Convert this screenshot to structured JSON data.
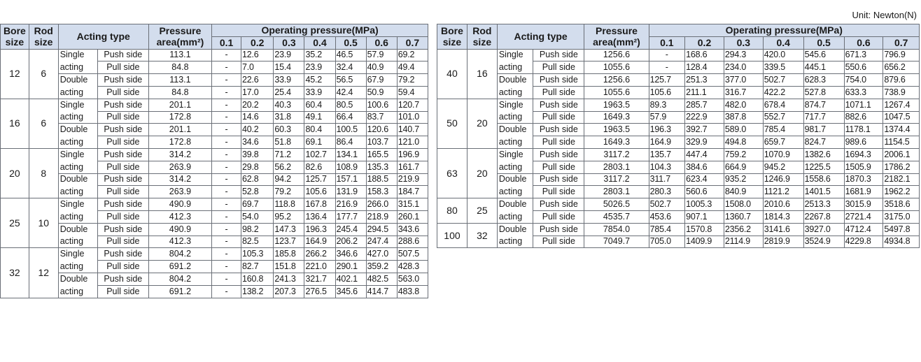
{
  "unit": "Unit: Newton(N)",
  "header": {
    "bore": [
      "Bore",
      "size"
    ],
    "rod": [
      "Rod",
      "size"
    ],
    "acting_type": "Acting type",
    "pressure_area": [
      "Pressure",
      "area(mm²)"
    ],
    "operating_pressure": "Operating pressure(MPa)",
    "pressures": [
      "0.1",
      "0.2",
      "0.3",
      "0.4",
      "0.5",
      "0.6",
      "0.7"
    ]
  },
  "left": [
    {
      "bore": "12",
      "rod": "6",
      "rows": [
        {
          "act": "Single",
          "side": "Push side",
          "area": "113.1",
          "vals": [
            "-",
            "12.6",
            "23.9",
            "35.2",
            "46.5",
            "57.9",
            "69.2"
          ]
        },
        {
          "act": "acting",
          "side": "Pull side",
          "area": "84.8",
          "vals": [
            "-",
            "7.0",
            "15.4",
            "23.9",
            "32.4",
            "40.9",
            "49.4"
          ]
        },
        {
          "act": "Double",
          "side": "Push side",
          "area": "113.1",
          "vals": [
            "-",
            "22.6",
            "33.9",
            "45.2",
            "56.5",
            "67.9",
            "79.2"
          ]
        },
        {
          "act": "acting",
          "side": "Pull side",
          "area": "84.8",
          "vals": [
            "-",
            "17.0",
            "25.4",
            "33.9",
            "42.4",
            "50.9",
            "59.4"
          ]
        }
      ]
    },
    {
      "bore": "16",
      "rod": "6",
      "rows": [
        {
          "act": "Single",
          "side": "Push side",
          "area": "201.1",
          "vals": [
            "-",
            "20.2",
            "40.3",
            "60.4",
            "80.5",
            "100.6",
            "120.7"
          ]
        },
        {
          "act": "acting",
          "side": "Pull side",
          "area": "172.8",
          "vals": [
            "-",
            "14.6",
            "31.8",
            "49.1",
            "66.4",
            "83.7",
            "101.0"
          ]
        },
        {
          "act": "Double",
          "side": "Push side",
          "area": "201.1",
          "vals": [
            "-",
            "40.2",
            "60.3",
            "80.4",
            "100.5",
            "120.6",
            "140.7"
          ]
        },
        {
          "act": "acting",
          "side": "Pull side",
          "area": "172.8",
          "vals": [
            "-",
            "34.6",
            "51.8",
            "69.1",
            "86.4",
            "103.7",
            "121.0"
          ]
        }
      ]
    },
    {
      "bore": "20",
      "rod": "8",
      "rows": [
        {
          "act": "Single",
          "side": "Push side",
          "area": "314.2",
          "vals": [
            "-",
            "39.8",
            "71.2",
            "102.7",
            "134.1",
            "165.5",
            "196.9"
          ]
        },
        {
          "act": "acting",
          "side": "Pull side",
          "area": "263.9",
          "vals": [
            "-",
            "29.8",
            "56.2",
            "82.6",
            "108.9",
            "135.3",
            "161.7"
          ]
        },
        {
          "act": "Double",
          "side": "Push side",
          "area": "314.2",
          "vals": [
            "-",
            "62.8",
            "94.2",
            "125.7",
            "157.1",
            "188.5",
            "219.9"
          ]
        },
        {
          "act": "acting",
          "side": "Pull side",
          "area": "263.9",
          "vals": [
            "-",
            "52.8",
            "79.2",
            "105.6",
            "131.9",
            "158.3",
            "184.7"
          ]
        }
      ]
    },
    {
      "bore": "25",
      "rod": "10",
      "rows": [
        {
          "act": "Single",
          "side": "Push side",
          "area": "490.9",
          "vals": [
            "-",
            "69.7",
            "118.8",
            "167.8",
            "216.9",
            "266.0",
            "315.1"
          ]
        },
        {
          "act": "acting",
          "side": "Pull side",
          "area": "412.3",
          "vals": [
            "-",
            "54.0",
            "95.2",
            "136.4",
            "177.7",
            "218.9",
            "260.1"
          ]
        },
        {
          "act": "Double",
          "side": "Push side",
          "area": "490.9",
          "vals": [
            "-",
            "98.2",
            "147.3",
            "196.3",
            "245.4",
            "294.5",
            "343.6"
          ]
        },
        {
          "act": "acting",
          "side": "Pull side",
          "area": "412.3",
          "vals": [
            "-",
            "82.5",
            "123.7",
            "164.9",
            "206.2",
            "247.4",
            "288.6"
          ]
        }
      ]
    },
    {
      "bore": "32",
      "rod": "12",
      "rows": [
        {
          "act": "Single",
          "side": "Push side",
          "area": "804.2",
          "vals": [
            "-",
            "105.3",
            "185.8",
            "266.2",
            "346.6",
            "427.0",
            "507.5"
          ]
        },
        {
          "act": "acting",
          "side": "Pull side",
          "area": "691.2",
          "vals": [
            "-",
            "82.7",
            "151.8",
            "221.0",
            "290.1",
            "359.2",
            "428.3"
          ]
        },
        {
          "act": "Double",
          "side": "Push side",
          "area": "804.2",
          "vals": [
            "-",
            "160.8",
            "241.3",
            "321.7",
            "402.1",
            "482.5",
            "563.0"
          ]
        },
        {
          "act": "acting",
          "side": "Pull side",
          "area": "691.2",
          "vals": [
            "-",
            "138.2",
            "207.3",
            "276.5",
            "345.6",
            "414.7",
            "483.8"
          ]
        }
      ]
    }
  ],
  "right": [
    {
      "bore": "40",
      "rod": "16",
      "rows": [
        {
          "act": "Single",
          "side": "Push side",
          "area": "1256.6",
          "vals": [
            "-",
            "168.6",
            "294.3",
            "420.0",
            "545.6",
            "671.3",
            "796.9"
          ]
        },
        {
          "act": "acting",
          "side": "Pull side",
          "area": "1055.6",
          "vals": [
            "-",
            "128.4",
            "234.0",
            "339.5",
            "445.1",
            "550.6",
            "656.2"
          ]
        },
        {
          "act": "Double",
          "side": "Push side",
          "area": "1256.6",
          "vals": [
            "125.7",
            "251.3",
            "377.0",
            "502.7",
            "628.3",
            "754.0",
            "879.6"
          ]
        },
        {
          "act": "acting",
          "side": "Pull side",
          "area": "1055.6",
          "vals": [
            "105.6",
            "211.1",
            "316.7",
            "422.2",
            "527.8",
            "633.3",
            "738.9"
          ]
        }
      ]
    },
    {
      "bore": "50",
      "rod": "20",
      "rows": [
        {
          "act": "Single",
          "side": "Push side",
          "area": "1963.5",
          "vals": [
            "89.3",
            "285.7",
            "482.0",
            "678.4",
            "874.7",
            "1071.1",
            "1267.4"
          ]
        },
        {
          "act": "acting",
          "side": "Pull side",
          "area": "1649.3",
          "vals": [
            "57.9",
            "222.9",
            "387.8",
            "552.7",
            "717.7",
            "882.6",
            "1047.5"
          ]
        },
        {
          "act": "Double",
          "side": "Push side",
          "area": "1963.5",
          "vals": [
            "196.3",
            "392.7",
            "589.0",
            "785.4",
            "981.7",
            "1178.1",
            "1374.4"
          ]
        },
        {
          "act": "acting",
          "side": "Pull side",
          "area": "1649.3",
          "vals": [
            "164.9",
            "329.9",
            "494.8",
            "659.7",
            "824.7",
            "989.6",
            "1154.5"
          ]
        }
      ]
    },
    {
      "bore": "63",
      "rod": "20",
      "rows": [
        {
          "act": "Single",
          "side": "Push side",
          "area": "3117.2",
          "vals": [
            "135.7",
            "447.4",
            "759.2",
            "1070.9",
            "1382.6",
            "1694.3",
            "2006.1"
          ]
        },
        {
          "act": "acting",
          "side": "Pull side",
          "area": "2803.1",
          "vals": [
            "104.3",
            "384.6",
            "664.9",
            "945.2",
            "1225.5",
            "1505.9",
            "1786.2"
          ]
        },
        {
          "act": "Double",
          "side": "Push side",
          "area": "3117.2",
          "vals": [
            "311.7",
            "623.4",
            "935.2",
            "1246.9",
            "1558.6",
            "1870.3",
            "2182.1"
          ]
        },
        {
          "act": "acting",
          "side": "Pull side",
          "area": "2803.1",
          "vals": [
            "280.3",
            "560.6",
            "840.9",
            "1121.2",
            "1401.5",
            "1681.9",
            "1962.2"
          ]
        }
      ]
    },
    {
      "bore": "80",
      "rod": "25",
      "rows": [
        {
          "act": "Double",
          "side": "Push side",
          "area": "5026.5",
          "vals": [
            "502.7",
            "1005.3",
            "1508.0",
            "2010.6",
            "2513.3",
            "3015.9",
            "3518.6"
          ]
        },
        {
          "act": "acting",
          "side": "Pull side",
          "area": "4535.7",
          "vals": [
            "453.6",
            "907.1",
            "1360.7",
            "1814.3",
            "2267.8",
            "2721.4",
            "3175.0"
          ]
        }
      ]
    },
    {
      "bore": "100",
      "rod": "32",
      "rows": [
        {
          "act": "Double",
          "side": "Push side",
          "area": "7854.0",
          "vals": [
            "785.4",
            "1570.8",
            "2356.2",
            "3141.6",
            "3927.0",
            "4712.4",
            "5497.8"
          ]
        },
        {
          "act": "acting",
          "side": "Pull side",
          "area": "7049.7",
          "vals": [
            "705.0",
            "1409.9",
            "2114.9",
            "2819.9",
            "3524.9",
            "4229.8",
            "4934.8"
          ]
        }
      ]
    }
  ]
}
